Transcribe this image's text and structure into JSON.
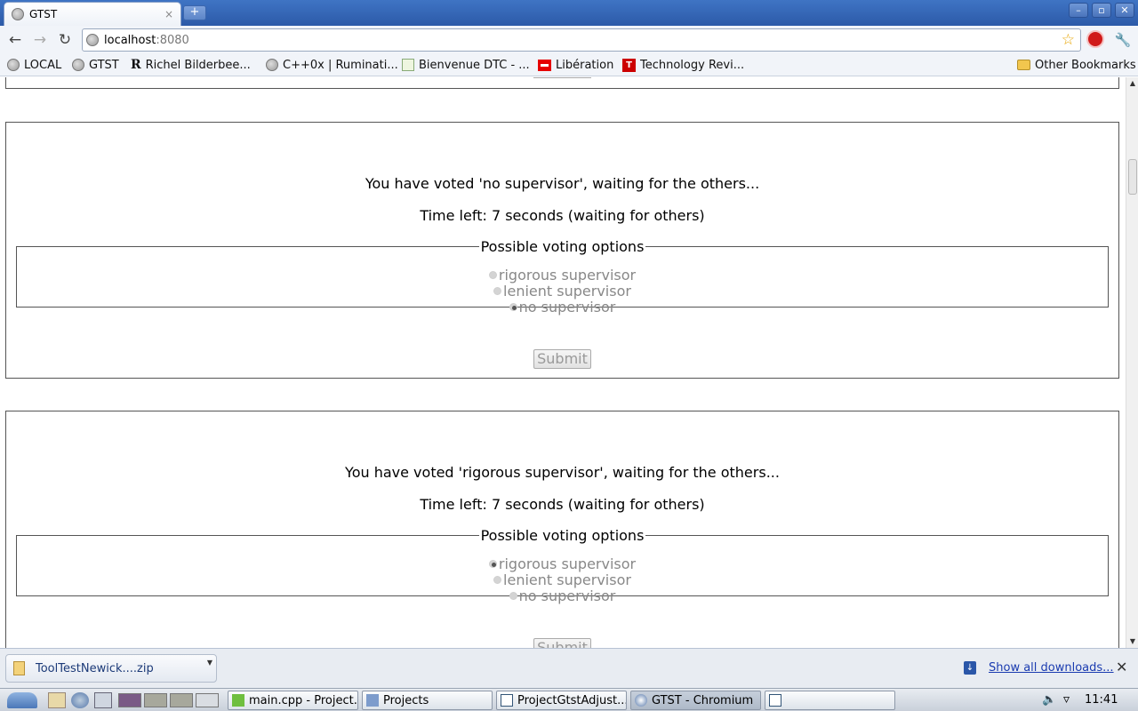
{
  "browser": {
    "tab_title": "GTST",
    "tab_close": "×",
    "new_tab": "+",
    "window_controls": [
      "–",
      "▫",
      "✕"
    ],
    "url_host": "localhost",
    "url_port": ":8080"
  },
  "bookmarks": [
    {
      "label": "LOCAL",
      "icon": "globe-icon"
    },
    {
      "label": "GTST",
      "icon": "globe-icon"
    },
    {
      "label": "Richel Bilderbee...",
      "icon": "r-logo-icon"
    },
    {
      "label": "C++0x | Ruminati...",
      "icon": "globe-icon"
    },
    {
      "label": "Bienvenue DTC - ...",
      "icon": "dtc-icon"
    },
    {
      "label": "Libération",
      "icon": "liberation-icon"
    },
    {
      "label": "Technology Revi...",
      "icon": "tr-icon"
    }
  ],
  "other_bookmarks": "Other Bookmarks",
  "panels": [
    {
      "status": "You have voted 'no supervisor', waiting for the others...",
      "time": "Time left: 7 seconds (waiting for others)",
      "legend": "Possible voting options",
      "options": [
        {
          "label": "rigorous supervisor",
          "checked": false
        },
        {
          "label": "lenient supervisor",
          "checked": false
        },
        {
          "label": "no supervisor",
          "checked": true
        }
      ],
      "submit": "Submit"
    },
    {
      "status": "You have voted 'rigorous supervisor', waiting for the others...",
      "time": "Time left: 7 seconds (waiting for others)",
      "legend": "Possible voting options",
      "options": [
        {
          "label": "rigorous supervisor",
          "checked": true
        },
        {
          "label": "lenient supervisor",
          "checked": false
        },
        {
          "label": "no supervisor",
          "checked": false
        }
      ],
      "submit": "Submit"
    }
  ],
  "downloads": {
    "file": "ToolTestNewick....zip",
    "show_all": "Show all downloads...",
    "close": "✕"
  },
  "taskbar": {
    "tasks": [
      {
        "label": "main.cpp - Project...",
        "icon": "qt-icon",
        "active": false
      },
      {
        "label": "Projects",
        "icon": "folder-icon",
        "active": false
      },
      {
        "label": "ProjectGtstAdjust...",
        "icon": "document-icon",
        "active": false
      },
      {
        "label": "GTST - Chromium",
        "icon": "chromium-icon",
        "active": true
      },
      {
        "label": "",
        "icon": "document-icon",
        "active": false
      }
    ],
    "clock": "11:41"
  }
}
